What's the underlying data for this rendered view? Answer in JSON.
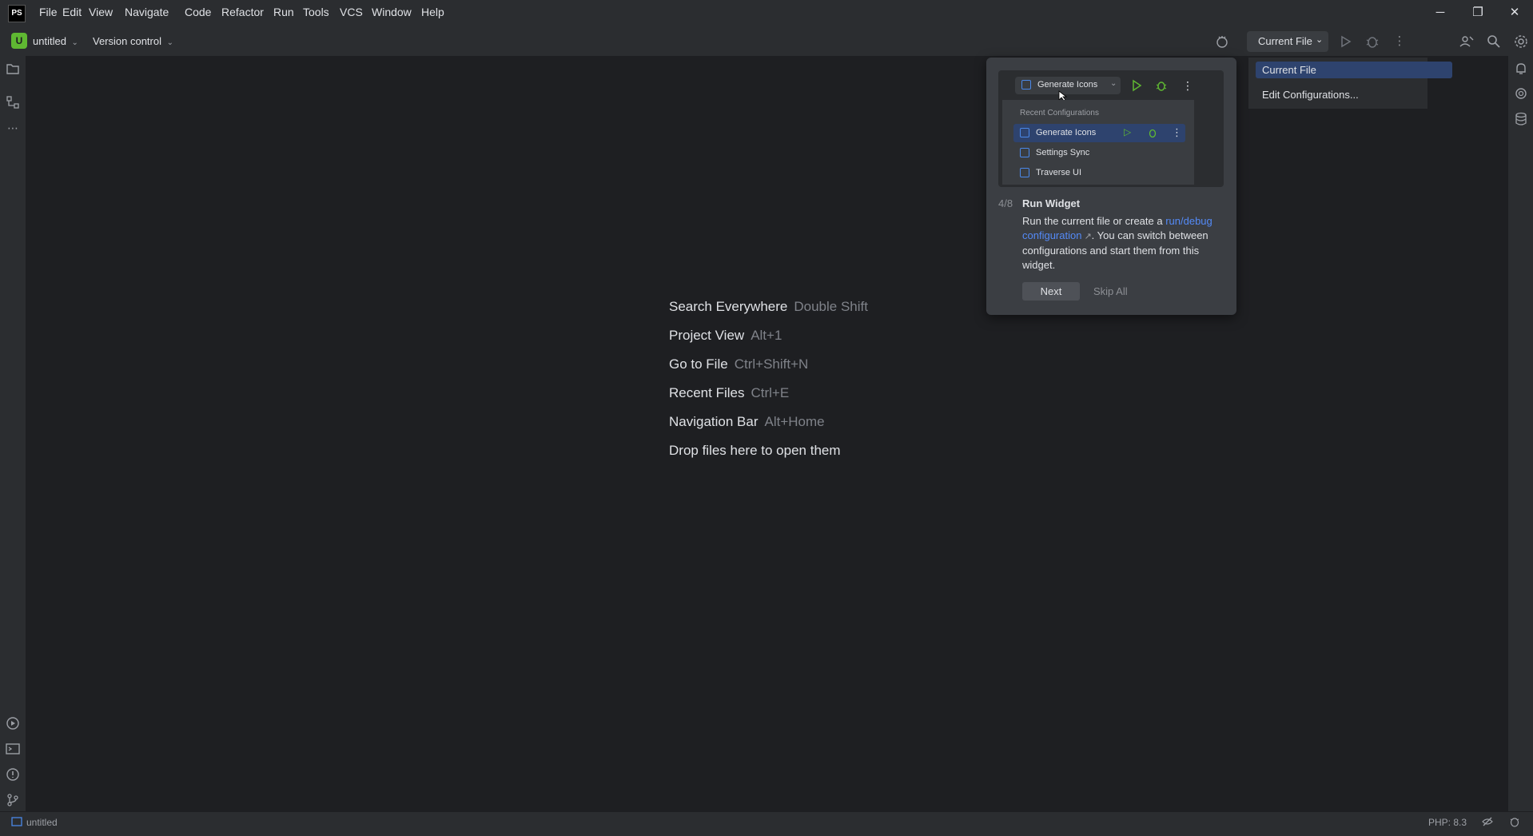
{
  "app": {
    "logo_text": "PS"
  },
  "menu": [
    "File",
    "Edit",
    "View",
    "Navigate",
    "Code",
    "Refactor",
    "Run",
    "Tools",
    "VCS",
    "Window",
    "Help"
  ],
  "window_controls": {
    "minimize": "─",
    "maximize": "❐",
    "close": "✕"
  },
  "toolbar": {
    "project_badge": "U",
    "project_name": "untitled",
    "version_control": "Version control",
    "run_config": "Current File"
  },
  "hints": [
    {
      "label": "Search Everywhere",
      "key": "Double Shift"
    },
    {
      "label": "Project View",
      "key": "Alt+1"
    },
    {
      "label": "Go to File",
      "key": "Ctrl+Shift+N"
    },
    {
      "label": "Recent Files",
      "key": "Ctrl+E"
    },
    {
      "label": "Navigation Bar",
      "key": "Alt+Home"
    },
    {
      "label": "Drop files here to open them",
      "key": ""
    }
  ],
  "tour": {
    "preview": {
      "top_config": "Generate Icons",
      "recent_header": "Recent Configurations",
      "recent": [
        "Generate Icons",
        "Settings Sync",
        "Traverse UI"
      ]
    },
    "step": "4/8",
    "title": "Run Widget",
    "body_before": "Run the current file or create a",
    "link": "run/debug configuration",
    "link_arrow": "↗",
    "body_after": ". You can switch between configurations and start them from this widget.",
    "next_label": "Next",
    "skip_label": "Skip All"
  },
  "run_config_popup": {
    "items": [
      "Current File",
      "Edit Configurations..."
    ]
  },
  "statusbar": {
    "project": "untitled",
    "php_version": "PHP: 8.3"
  }
}
